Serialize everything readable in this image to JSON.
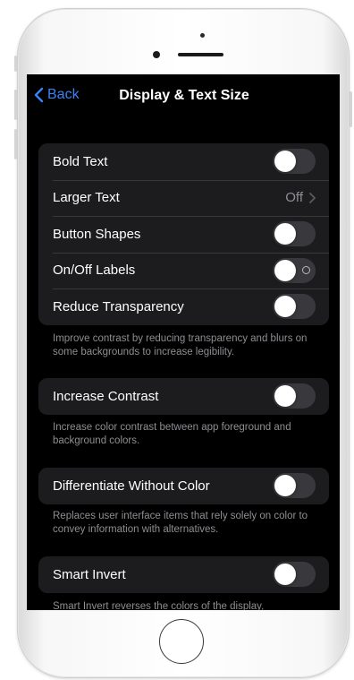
{
  "nav": {
    "back_label": "Back",
    "title": "Display & Text Size"
  },
  "group1": {
    "rows": [
      {
        "label": "Bold Text",
        "type": "toggle",
        "on": false
      },
      {
        "label": "Larger Text",
        "type": "value",
        "value": "Off"
      },
      {
        "label": "Button Shapes",
        "type": "toggle",
        "on": false
      },
      {
        "label": "On/Off Labels",
        "type": "toggle",
        "on": false
      },
      {
        "label": "Reduce Transparency",
        "type": "toggle",
        "on": false
      }
    ],
    "footer": "Improve contrast by reducing transparency and blurs on some backgrounds to increase legibility."
  },
  "group2": {
    "label": "Increase Contrast",
    "on": false,
    "footer": "Increase color contrast between app foreground and background colors."
  },
  "group3": {
    "label": "Differentiate Without Color",
    "on": false,
    "footer": "Replaces user interface items that rely solely on color to convey information with alternatives."
  },
  "group4": {
    "label": "Smart Invert",
    "on": false,
    "footer": "Smart Invert reverses the colors of the display,"
  },
  "colors": {
    "accent": "#3b82f6",
    "background": "#000000",
    "cell": "#1c1c1e",
    "toggle_off": "#39393d",
    "secondary_text": "#8e8e93"
  },
  "icons": {
    "back": "chevron-left-icon",
    "disclosure": "chevron-right-icon"
  }
}
